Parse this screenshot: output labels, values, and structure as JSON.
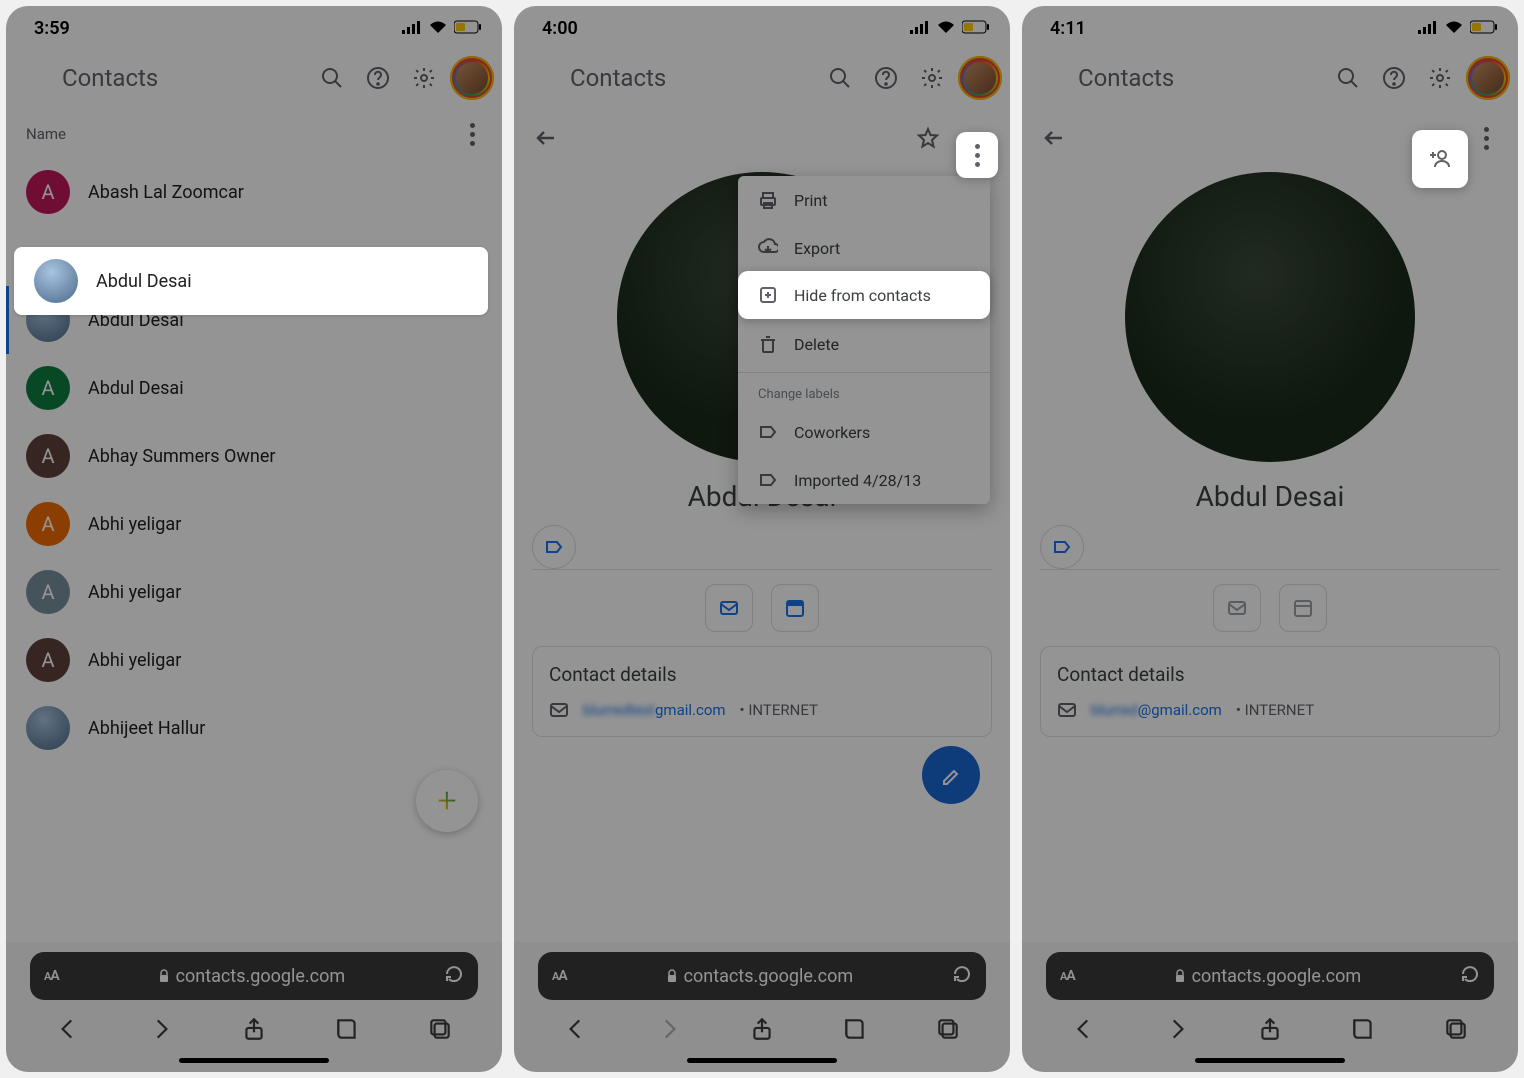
{
  "screens": {
    "s1": {
      "time": "3:59",
      "app_title": "Contacts",
      "subheader": "Name",
      "contacts": [
        {
          "name": "Abash Lal Zoomcar",
          "color": "#c2185b",
          "initial": "A"
        },
        {
          "name": "Abdul Desai",
          "photo": true
        },
        {
          "name": "Abdul Desai",
          "photo": true
        },
        {
          "name": "Abdul Desai",
          "color": "#0d7f3f",
          "initial": "A"
        },
        {
          "name": "Abhay Summers Owner",
          "color": "#5d4037",
          "initial": "A"
        },
        {
          "name": "Abhi yeligar",
          "color": "#ef6c00",
          "initial": "A"
        },
        {
          "name": "Abhi yeligar",
          "color": "#78909c",
          "initial": "A"
        },
        {
          "name": "Abhi yeligar",
          "color": "#5d4037",
          "initial": "A"
        },
        {
          "name": "Abhijeet Hallur",
          "photo": true
        }
      ],
      "url": "contacts.google.com"
    },
    "s2": {
      "time": "4:00",
      "app_title": "Contacts",
      "contact_name": "Abdul Desai",
      "menu": {
        "print": "Print",
        "export": "Export",
        "hide": "Hide from contacts",
        "delete": "Delete",
        "change_labels": "Change labels",
        "coworkers": "Coworkers",
        "imported": "Imported 4/28/13"
      },
      "details_title": "Contact details",
      "email_suffix": "gmail.com",
      "email_tag": "INTERNET",
      "url": "contacts.google.com"
    },
    "s3": {
      "time": "4:11",
      "app_title": "Contacts",
      "contact_name": "Abdul Desai",
      "details_title": "Contact details",
      "email_suffix": "@gmail.com",
      "email_tag": "INTERNET",
      "url": "contacts.google.com"
    }
  }
}
